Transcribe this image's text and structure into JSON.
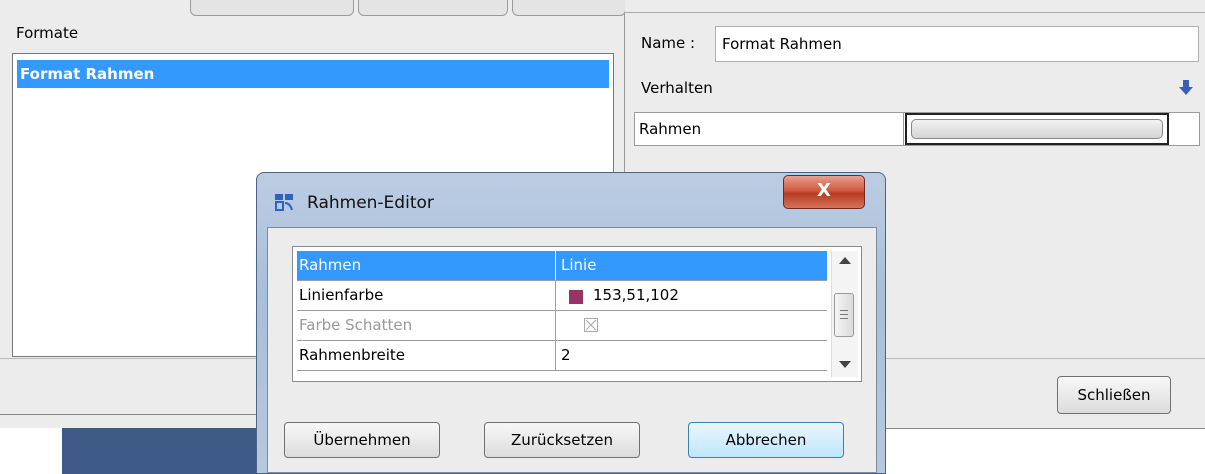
{
  "left_panel": {
    "title": "Formate",
    "list_items": [
      "Format Rahmen"
    ]
  },
  "right_panel": {
    "name_label": "Name :",
    "name_value": "Format Rahmen",
    "behavior_label": "Verhalten",
    "row_label": "Rahmen",
    "close_label": "Schließen",
    "icons": {
      "collapse": "down-arrow-icon"
    }
  },
  "dialog": {
    "title": "Rahmen-Editor",
    "close_glyph": "X",
    "table": {
      "header": [
        "Rahmen",
        "Linie"
      ],
      "rows": [
        {
          "label": "Linienfarbe",
          "value": "153,51,102",
          "swatch_color": "#993366"
        },
        {
          "label": "Farbe Schatten",
          "value": "",
          "disabled": true
        },
        {
          "label": "Rahmenbreite",
          "value": "2"
        }
      ]
    },
    "buttons": {
      "apply": "Übernehmen",
      "reset": "Zurücksetzen",
      "cancel": "Abbrechen"
    }
  },
  "colors": {
    "selection": "#3399ff",
    "line_color": "#993366"
  }
}
